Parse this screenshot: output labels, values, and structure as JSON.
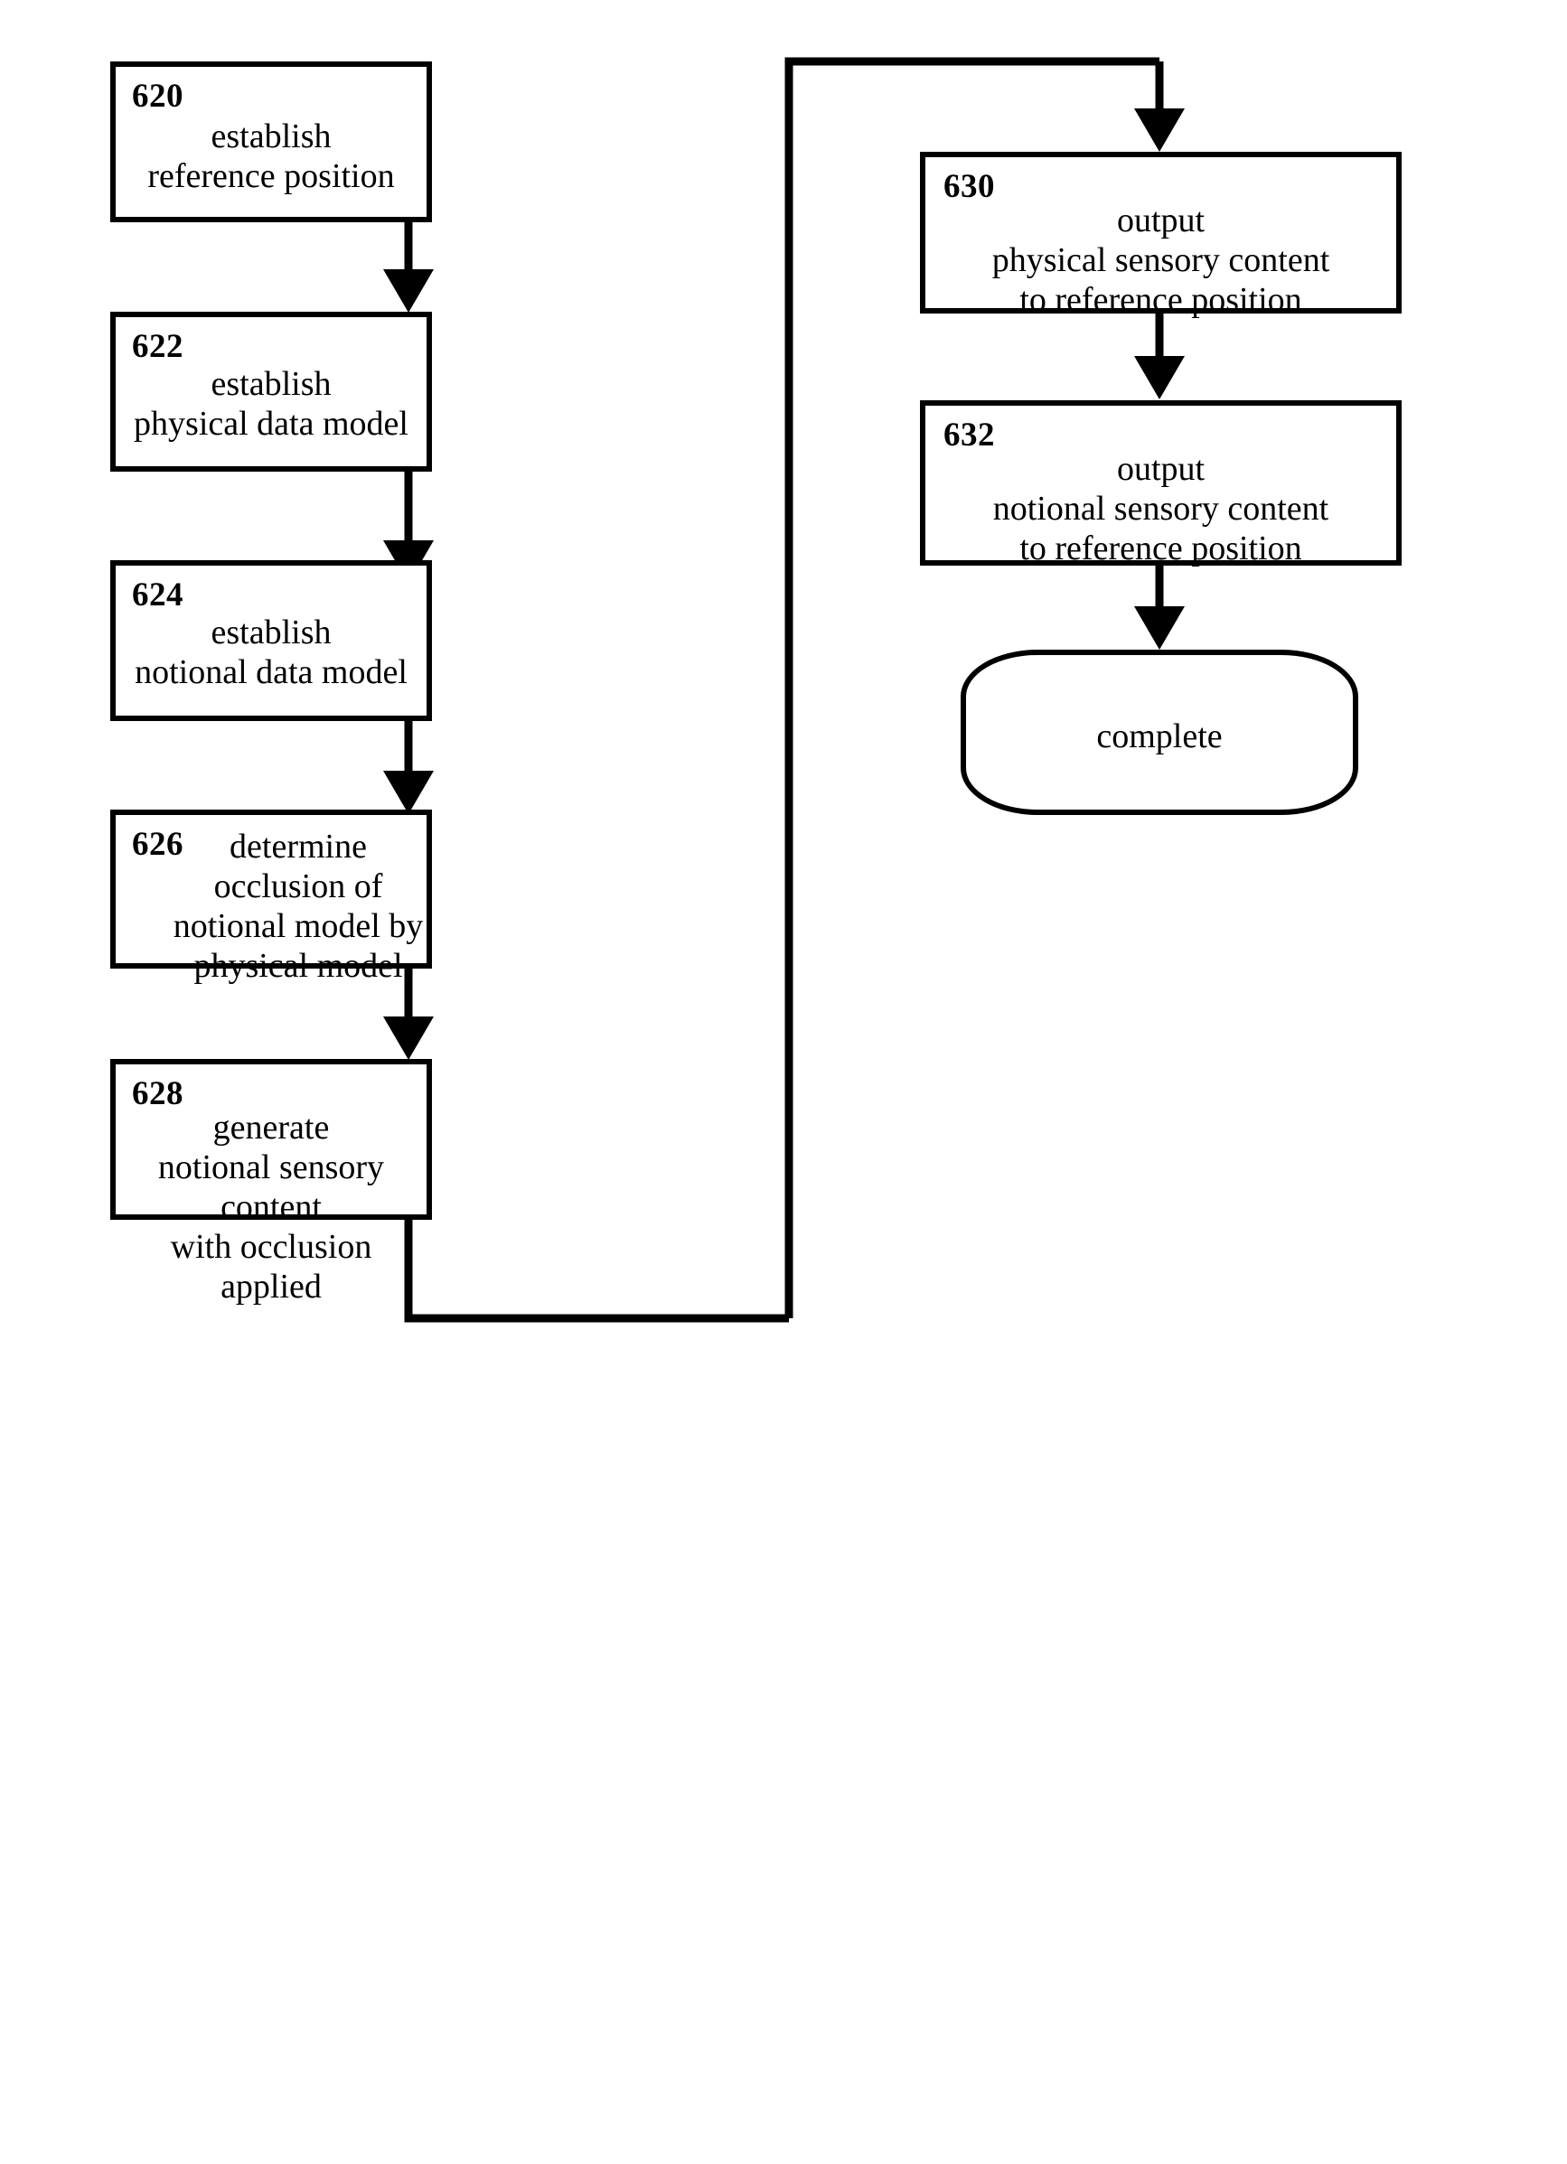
{
  "figure": {
    "type": "flowchart",
    "background": "#ffffff",
    "stroke": "#000000"
  },
  "nodes": [
    {
      "id": "620",
      "number": "620",
      "label": "establish\nreference position",
      "shape": "rect",
      "column": "left"
    },
    {
      "id": "622",
      "number": "622",
      "label": "establish\nphysical data model",
      "shape": "rect",
      "column": "left"
    },
    {
      "id": "624",
      "number": "624",
      "label": "establish\nnotional data model",
      "shape": "rect",
      "column": "left"
    },
    {
      "id": "626",
      "number": "626",
      "label": "determine\nocclusion of\nnotional model by\nphysical model",
      "shape": "rect",
      "column": "left"
    },
    {
      "id": "628",
      "number": "628",
      "label": "generate\nnotional sensory content\nwith occlusion applied",
      "shape": "rect",
      "column": "left"
    },
    {
      "id": "630",
      "number": "630",
      "label": "output\nphysical sensory content\nto reference position",
      "shape": "rect",
      "column": "right"
    },
    {
      "id": "632",
      "number": "632",
      "label": "output\nnotional sensory content\nto reference position",
      "shape": "rect",
      "column": "right"
    },
    {
      "id": "complete",
      "number": "",
      "label": "complete",
      "shape": "rounded-terminal",
      "column": "right"
    }
  ],
  "edges": [
    {
      "from": "620",
      "to": "622",
      "kind": "arrow-down"
    },
    {
      "from": "622",
      "to": "624",
      "kind": "arrow-down"
    },
    {
      "from": "624",
      "to": "626",
      "kind": "arrow-down"
    },
    {
      "from": "626",
      "to": "628",
      "kind": "arrow-down"
    },
    {
      "from": "628",
      "to": "630",
      "kind": "routed-arrow-down-left-up-right"
    },
    {
      "from": "630",
      "to": "632",
      "kind": "arrow-down"
    },
    {
      "from": "632",
      "to": "complete",
      "kind": "arrow-down"
    }
  ]
}
